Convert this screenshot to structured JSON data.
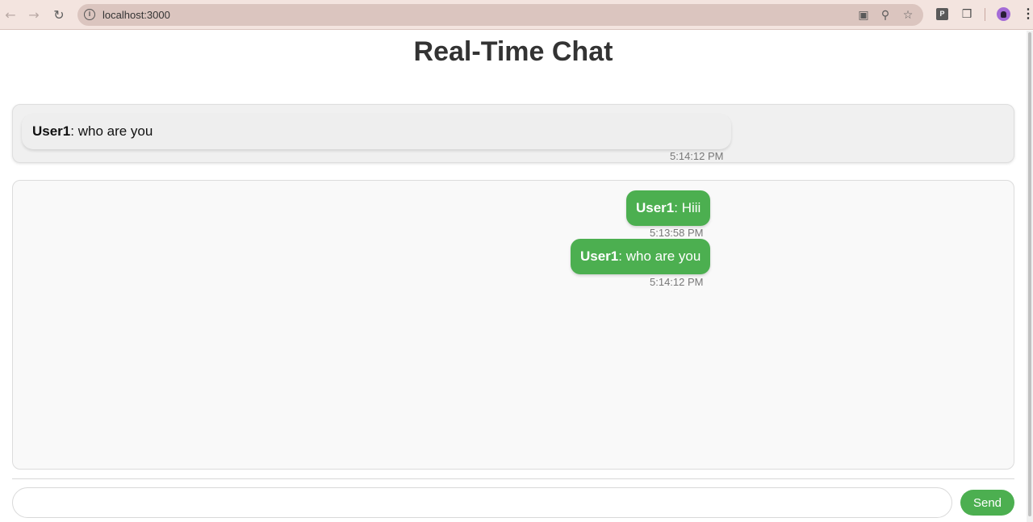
{
  "browser": {
    "url": "localhost:3000",
    "back_icon": "back-arrow-icon",
    "forward_icon": "forward-arrow-icon",
    "reload_icon": "reload-icon"
  },
  "page": {
    "title": "Real-Time Chat"
  },
  "preview": {
    "username": "User1",
    "text": ": who are you",
    "time": "5:14:12 PM"
  },
  "messages": [
    {
      "username": "User1",
      "text": ": Hiii",
      "time": "5:13:58 PM"
    },
    {
      "username": "User1",
      "text": ": who are you",
      "time": "5:14:12 PM"
    }
  ],
  "composer": {
    "placeholder": "",
    "send_label": "Send"
  },
  "colors": {
    "accent": "#4caf50",
    "browser_chrome": "#f3e4df",
    "address_bar": "#dbc5bf"
  }
}
